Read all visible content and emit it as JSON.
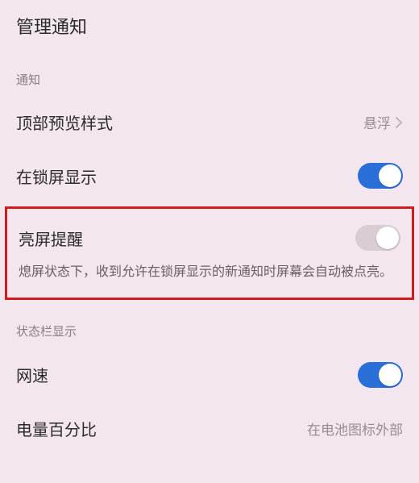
{
  "page_title": "管理通知",
  "sections": {
    "notifications_header": "通知",
    "preview_style": {
      "label": "顶部预览样式",
      "value": "悬浮"
    },
    "lockscreen_show": {
      "label": "在锁屏显示",
      "toggled": true
    },
    "wake_reminder": {
      "label": "亮屏提醒",
      "toggled": false,
      "description": "熄屏状态下，收到允许在锁屏显示的新通知时屏幕会自动被点亮。"
    },
    "statusbar_header": "状态栏显示",
    "net_speed": {
      "label": "网速",
      "toggled": true
    },
    "battery_percent": {
      "label": "电量百分比",
      "value": "在电池图标外部"
    }
  }
}
